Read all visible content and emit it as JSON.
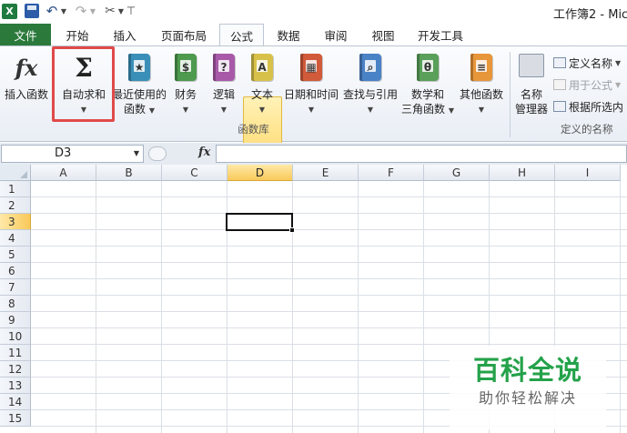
{
  "window": {
    "title": "工作簿2 - Mic"
  },
  "quick_access": {
    "app_icon": "excel-icon",
    "save_icon": "save-icon",
    "undo_icon": "undo-icon",
    "redo_icon": "redo-icon",
    "tools_icon": "tools-icon"
  },
  "tabs": [
    {
      "label": "文件"
    },
    {
      "label": "开始"
    },
    {
      "label": "插入"
    },
    {
      "label": "页面布局"
    },
    {
      "label": "公式"
    },
    {
      "label": "数据"
    },
    {
      "label": "审阅"
    },
    {
      "label": "视图"
    },
    {
      "label": "开发工具"
    }
  ],
  "active_tab": "公式",
  "ribbon": {
    "insert_function": {
      "line1": "插入函数",
      "glyph": "fx"
    },
    "autosum": {
      "line1": "自动求和",
      "glyph": "Σ"
    },
    "recent": {
      "line1": "最近使用的",
      "line2": "函数"
    },
    "finance": {
      "line1": "财务"
    },
    "logic": {
      "line1": "逻辑",
      "glyph": "?"
    },
    "text": {
      "line1": "文本",
      "glyph": "A"
    },
    "datetime": {
      "line1": "日期和时间"
    },
    "lookup": {
      "line1": "查找与引用"
    },
    "math": {
      "line1": "数学和",
      "line2": "三角函数",
      "glyph": "θ"
    },
    "more": {
      "line1": "其他函数"
    },
    "function_library_label": "函数库",
    "name_manager": {
      "line1": "名称",
      "line2": "管理器"
    },
    "define_name": "定义名称",
    "use_in_formula": "用于公式",
    "create_from_selection": "根据所选内",
    "defined_names_label": "定义的名称"
  },
  "formula_bar": {
    "name_box": "D3",
    "fx_label": "fx",
    "value": ""
  },
  "grid": {
    "columns": [
      "A",
      "B",
      "C",
      "D",
      "E",
      "F",
      "G",
      "H",
      "I"
    ],
    "rows": [
      "1",
      "2",
      "3",
      "4",
      "5",
      "6",
      "7",
      "8",
      "9",
      "10",
      "11",
      "12",
      "13",
      "14",
      "15"
    ],
    "active_cell": "D3",
    "active_column": "D",
    "active_row": "3"
  },
  "watermark": {
    "title": "百科全说",
    "subtitle": "助你轻松解决"
  },
  "colors": {
    "file_tab": "#2b7a3c",
    "highlight": "#e04a4a",
    "selected_header": "#f9c95a",
    "watermark_green": "#24a24a"
  }
}
